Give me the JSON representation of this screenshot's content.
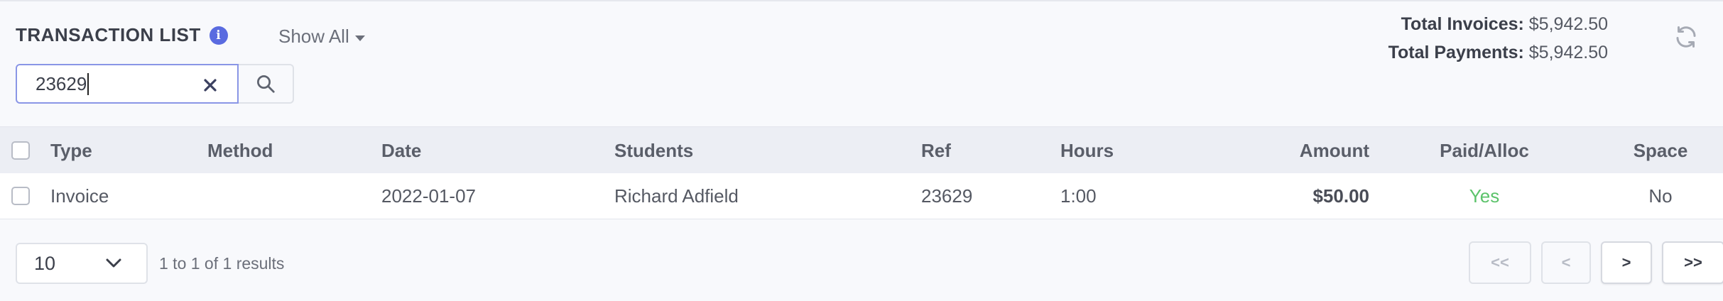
{
  "header": {
    "title": "TRANSACTION LIST",
    "info_icon_glyph": "i",
    "filter_label": "Show All",
    "totals": {
      "invoices_label": "Total Invoices:",
      "invoices_value": "$5,942.50",
      "payments_label": "Total Payments:",
      "payments_value": "$5,942.50"
    },
    "refresh_icon": "refresh-icon"
  },
  "search": {
    "value": "23629",
    "clear_icon": "close-icon",
    "submit_icon": "search-icon"
  },
  "table": {
    "columns": {
      "type": "Type",
      "method": "Method",
      "date": "Date",
      "students": "Students",
      "ref": "Ref",
      "hours": "Hours",
      "amount": "Amount",
      "paid": "Paid/Alloc",
      "space": "Space"
    },
    "rows": [
      {
        "type": "Invoice",
        "method": "",
        "date": "2022-01-07",
        "students": "Richard Adfield",
        "ref": "23629",
        "hours": "1:00",
        "amount": "$50.00",
        "paid": "Yes",
        "space": "No"
      }
    ]
  },
  "footer": {
    "page_size": "10",
    "results_text": "1 to 1 of 1 results",
    "pager": {
      "first": "<<",
      "prev": "<",
      "next": ">",
      "last": ">>"
    }
  },
  "colors": {
    "accent": "#5a6be0",
    "paid_yes": "#5cc36b",
    "search_border": "#8a96e6"
  }
}
